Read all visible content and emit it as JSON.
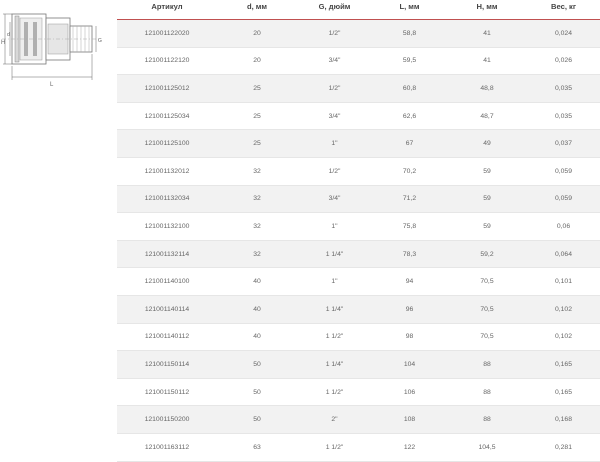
{
  "table": {
    "headers": [
      "Артикул",
      "d, мм",
      "G, дюйм",
      "L, мм",
      "H, мм",
      "Вес, кг"
    ],
    "rows": [
      [
        "121001122020",
        "20",
        "1/2\"",
        "58,8",
        "41",
        "0,024"
      ],
      [
        "121001122120",
        "20",
        "3/4\"",
        "59,5",
        "41",
        "0,026"
      ],
      [
        "121001125012",
        "25",
        "1/2\"",
        "60,8",
        "48,8",
        "0,035"
      ],
      [
        "121001125034",
        "25",
        "3/4\"",
        "62,6",
        "48,7",
        "0,035"
      ],
      [
        "121001125100",
        "25",
        "1\"",
        "67",
        "49",
        "0,037"
      ],
      [
        "121001132012",
        "32",
        "1/2\"",
        "70,2",
        "59",
        "0,059"
      ],
      [
        "121001132034",
        "32",
        "3/4\"",
        "71,2",
        "59",
        "0,059"
      ],
      [
        "121001132100",
        "32",
        "1\"",
        "75,8",
        "59",
        "0,06"
      ],
      [
        "121001132114",
        "32",
        "1 1/4\"",
        "78,3",
        "59,2",
        "0,064"
      ],
      [
        "121001140100",
        "40",
        "1\"",
        "94",
        "70,5",
        "0,101"
      ],
      [
        "121001140114",
        "40",
        "1 1/4\"",
        "96",
        "70,5",
        "0,102"
      ],
      [
        "121001140112",
        "40",
        "1 1/2\"",
        "98",
        "70,5",
        "0,102"
      ],
      [
        "121001150114",
        "50",
        "1 1/4\"",
        "104",
        "88",
        "0,165"
      ],
      [
        "121001150112",
        "50",
        "1 1/2\"",
        "106",
        "88",
        "0,165"
      ],
      [
        "121001150200",
        "50",
        "2\"",
        "108",
        "88",
        "0,168"
      ],
      [
        "121001163112",
        "63",
        "1 1/2\"",
        "122",
        "104,5",
        "0,281"
      ]
    ]
  },
  "drawing": {
    "labels": {
      "height": "H",
      "diameter": "d",
      "thread": "G",
      "length": "L"
    }
  },
  "colors": {
    "header_rule": "#c05050",
    "stripe": "#f2f2f2"
  }
}
